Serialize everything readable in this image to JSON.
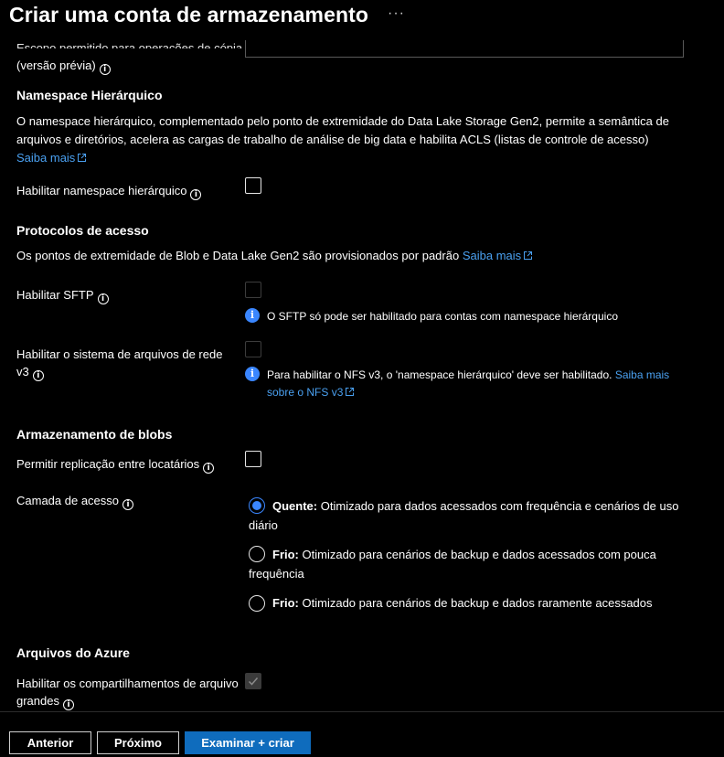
{
  "header": {
    "title": "Criar uma conta de armazenamento",
    "more": "···"
  },
  "top_partial": {
    "label_cut": "Escopo permitido para operações de cópia",
    "label_line2": "(versão prévia)"
  },
  "hierarchical": {
    "heading": "Namespace Hierárquico",
    "description": "O namespace hierárquico, complementado pelo ponto de extremidade do Data Lake Storage Gen2, permite a semântica de arquivos e diretórios, acelera as cargas de trabalho de análise de big data e habilita ACLS (listas de controle de acesso)",
    "learn_more": "Saiba mais",
    "enable_label": "Habilitar namespace hierárquico"
  },
  "protocols": {
    "heading": "Protocolos de acesso",
    "description": "Os pontos de extremidade de Blob e Data Lake Gen2 são provisionados por padrão",
    "learn_more": "Saiba mais",
    "sftp_label": "Habilitar SFTP",
    "sftp_info": "O SFTP só pode ser habilitado para contas com namespace hierárquico",
    "nfs_label_line1": "Habilitar o sistema de arquivos de rede",
    "nfs_label_line2": "v3",
    "nfs_info": "Para habilitar o NFS v3, o 'namespace hierárquico' deve ser habilitado.",
    "nfs_learn_more_1": "Saiba mais",
    "nfs_learn_more_2": "sobre o NFS v3"
  },
  "blob": {
    "heading": "Armazenamento de blobs",
    "cross_tenant_label": "Permitir replicação entre locatários",
    "access_tier_label": "Camada de acesso",
    "options": [
      {
        "name": "Quente:",
        "text": "Otimizado para dados acessados com frequência e cenários de uso diário",
        "selected": true
      },
      {
        "name": "Frio:",
        "text": "Otimizado para cenários de backup e dados acessados com pouca frequência",
        "selected": false
      },
      {
        "name": "Frio:",
        "text": "Otimizado para cenários de backup e dados raramente acessados",
        "selected": false
      }
    ]
  },
  "azure_files": {
    "heading": "Arquivos do Azure",
    "large_shares_line1": "Habilitar os compartilhamentos de arquivo",
    "large_shares_line2": "grandes"
  },
  "footer": {
    "previous": "Anterior",
    "next": "Próximo",
    "review_create": "Examinar + criar"
  },
  "colors": {
    "background": "#000000",
    "link": "#4aa0f0",
    "accent": "#0f6cbd",
    "info_blue": "#3a86ff"
  },
  "icons": {
    "info": "info-circle-icon",
    "external": "external-link-icon",
    "more": "more-ellipsis-icon",
    "check": "checkmark-icon"
  }
}
